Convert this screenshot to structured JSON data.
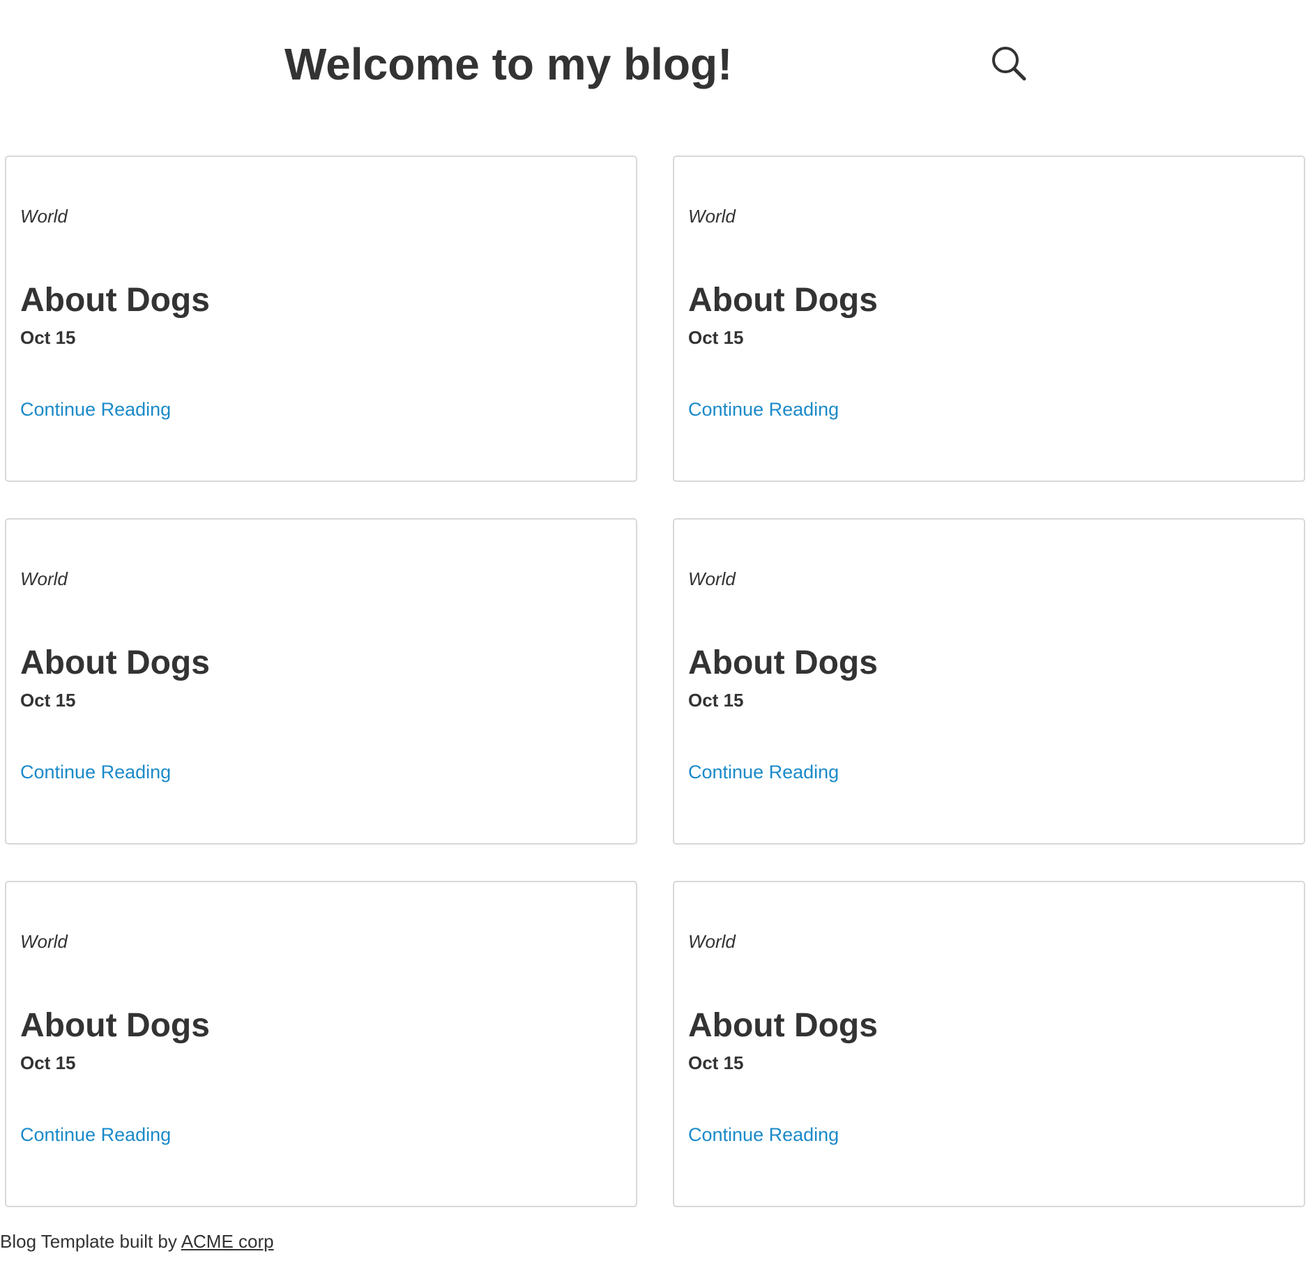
{
  "header": {
    "title": "Welcome to my blog!",
    "search_icon": "search-icon"
  },
  "posts": [
    {
      "category": "World",
      "title": "About Dogs",
      "date": "Oct 15",
      "link_label": "Continue Reading"
    },
    {
      "category": "World",
      "title": "About Dogs",
      "date": "Oct 15",
      "link_label": "Continue Reading"
    },
    {
      "category": "World",
      "title": "About Dogs",
      "date": "Oct 15",
      "link_label": "Continue Reading"
    },
    {
      "category": "World",
      "title": "About Dogs",
      "date": "Oct 15",
      "link_label": "Continue Reading"
    },
    {
      "category": "World",
      "title": "About Dogs",
      "date": "Oct 15",
      "link_label": "Continue Reading"
    },
    {
      "category": "World",
      "title": "About Dogs",
      "date": "Oct 15",
      "link_label": "Continue Reading"
    }
  ],
  "footer": {
    "text": "Blog Template built by ",
    "link_label": "ACME corp"
  },
  "colors": {
    "text": "#333333",
    "link": "#1b8ac9",
    "card_border": "#d8d8d8"
  }
}
